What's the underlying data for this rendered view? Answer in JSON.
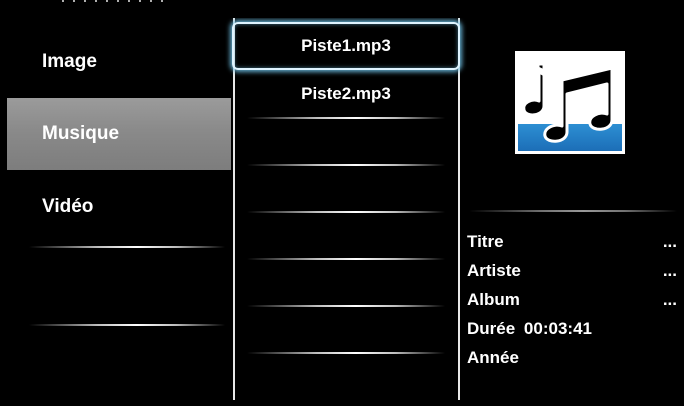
{
  "top_clip_text": "·  · · · · · · · · ·",
  "categories": [
    {
      "label": "Image",
      "selected": false
    },
    {
      "label": "Musique",
      "selected": true
    },
    {
      "label": "Vidéo",
      "selected": false
    }
  ],
  "files": [
    {
      "label": "Piste1.mp3",
      "focused": true
    },
    {
      "label": "Piste2.mp3",
      "focused": false
    }
  ],
  "thumbnail_icon": "music-notes-icon",
  "details": {
    "titre_label": "Titre",
    "titre_value": "...",
    "artiste_label": "Artiste",
    "artiste_value": "...",
    "album_label": "Album",
    "album_value": "...",
    "duree_label": "Durée",
    "duree_value": "00:03:41",
    "annee_label": "Année"
  },
  "colors": {
    "background": "#000000",
    "selected_category": "#8a8a8a",
    "focus_glow": "#6ebee1",
    "thumbnail_bar": "#2d8fd3"
  }
}
